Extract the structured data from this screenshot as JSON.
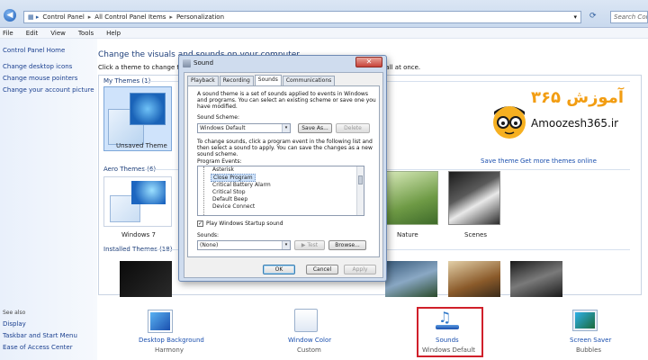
{
  "address_bar": {
    "crumbs": [
      "Control Panel",
      "All Control Panel Items",
      "Personalization"
    ],
    "search_placeholder": "Search Control Panel"
  },
  "menu": [
    "File",
    "Edit",
    "View",
    "Tools",
    "Help"
  ],
  "left_pane": {
    "links": [
      "Control Panel Home",
      "Change desktop icons",
      "Change mouse pointers",
      "Change your account picture"
    ],
    "see_also_heading": "See also",
    "see_also": [
      "Display",
      "Taskbar and Start Menu",
      "Ease of Access Center"
    ]
  },
  "main": {
    "title": "Change the visuals and sounds on your computer",
    "subtitle": "Click a theme to change the desktop background, window color, sounds, and screen saver all at once.",
    "my_themes": "My Themes (1)",
    "unsaved_theme": "Unsaved Theme",
    "save_theme": "Save theme",
    "get_more_themes": "Get more themes online",
    "aero_themes": "Aero Themes (6)",
    "windows7": "Windows 7",
    "nature": "Nature",
    "scenes": "Scenes",
    "installed_themes": "Installed Themes (18)"
  },
  "brand": {
    "farsi": "آموزش ۳۶۵",
    "english": "Amoozesh365.ir"
  },
  "bottom": [
    {
      "label": "Desktop Background",
      "value": "Harmony"
    },
    {
      "label": "Window Color",
      "value": "Custom"
    },
    {
      "label": "Sounds",
      "value": "Windows Default"
    },
    {
      "label": "Screen Saver",
      "value": "Bubbles"
    }
  ],
  "dialog": {
    "title": "Sound",
    "tabs": [
      "Playback",
      "Recording",
      "Sounds",
      "Communications"
    ],
    "intro": [
      "A sound theme is a set of sounds applied to events in Windows",
      "and programs.  You can select an existing scheme or save one you",
      "have modified."
    ],
    "scheme_label": "Sound Scheme:",
    "scheme_value": "Windows Default",
    "save_as": "Save As...",
    "delete": "Delete",
    "instructions": [
      "To change sounds, click a program event in the following list and",
      "then select a sound to apply.  You can save the changes as a new",
      "sound scheme."
    ],
    "events_label": "Program Events:",
    "events": [
      "Asterisk",
      "Close Program",
      "Critical Battery Alarm",
      "Critical Stop",
      "Default Beep",
      "Device Connect"
    ],
    "startup_label": "Play Windows Startup sound",
    "sounds_label": "Sounds:",
    "sounds_value": "(None)",
    "test": "Test",
    "browse": "Browse...",
    "ok": "OK",
    "cancel": "Cancel",
    "apply": "Apply"
  }
}
